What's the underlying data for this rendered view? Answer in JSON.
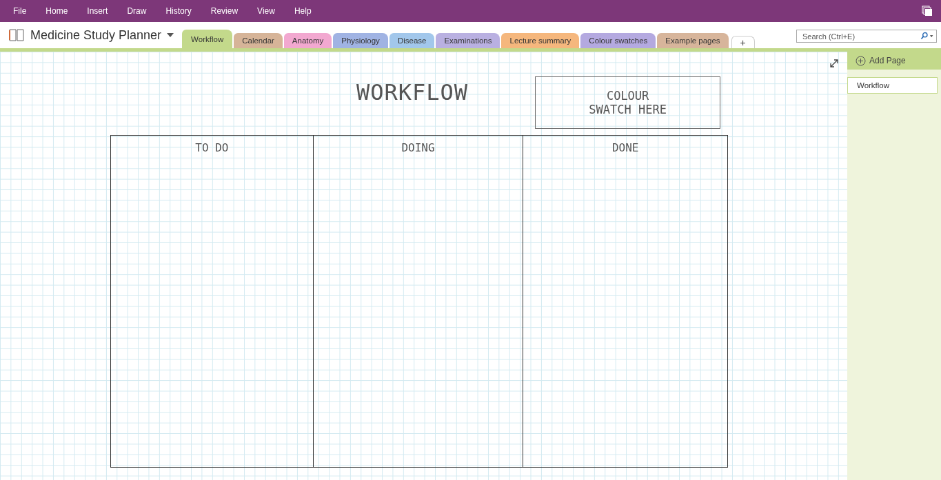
{
  "menu": [
    "File",
    "Home",
    "Insert",
    "Draw",
    "History",
    "Review",
    "View",
    "Help"
  ],
  "notebook": {
    "title": "Medicine Study Planner"
  },
  "sections": [
    {
      "label": "Workflow",
      "selected": true,
      "color": "#c3d98b"
    },
    {
      "label": "Calendar",
      "selected": false,
      "color": "#d6b498"
    },
    {
      "label": "Anatomy",
      "selected": false,
      "color": "#f2a8d0"
    },
    {
      "label": "Physiology",
      "selected": false,
      "color": "#a0b3e3"
    },
    {
      "label": "Disease",
      "selected": false,
      "color": "#a2c7eb"
    },
    {
      "label": "Examinations",
      "selected": false,
      "color": "#b9b0e1"
    },
    {
      "label": "Lecture summary",
      "selected": false,
      "color": "#f5b77d"
    },
    {
      "label": "Colour swatches",
      "selected": false,
      "color": "#b4a9e0"
    },
    {
      "label": "Example pages",
      "selected": false,
      "color": "#d7b59b"
    }
  ],
  "add_section": "+",
  "search": {
    "placeholder": "Search (Ctrl+E)"
  },
  "add_page": "Add Page",
  "pages": [
    {
      "title": "Workflow",
      "selected": true
    }
  ],
  "canvas": {
    "title": "WORKFLOW",
    "note_lines": [
      "COLOUR",
      "SWATCH HERE"
    ],
    "columns": [
      "TO DO",
      "DOING",
      "DONE"
    ]
  }
}
